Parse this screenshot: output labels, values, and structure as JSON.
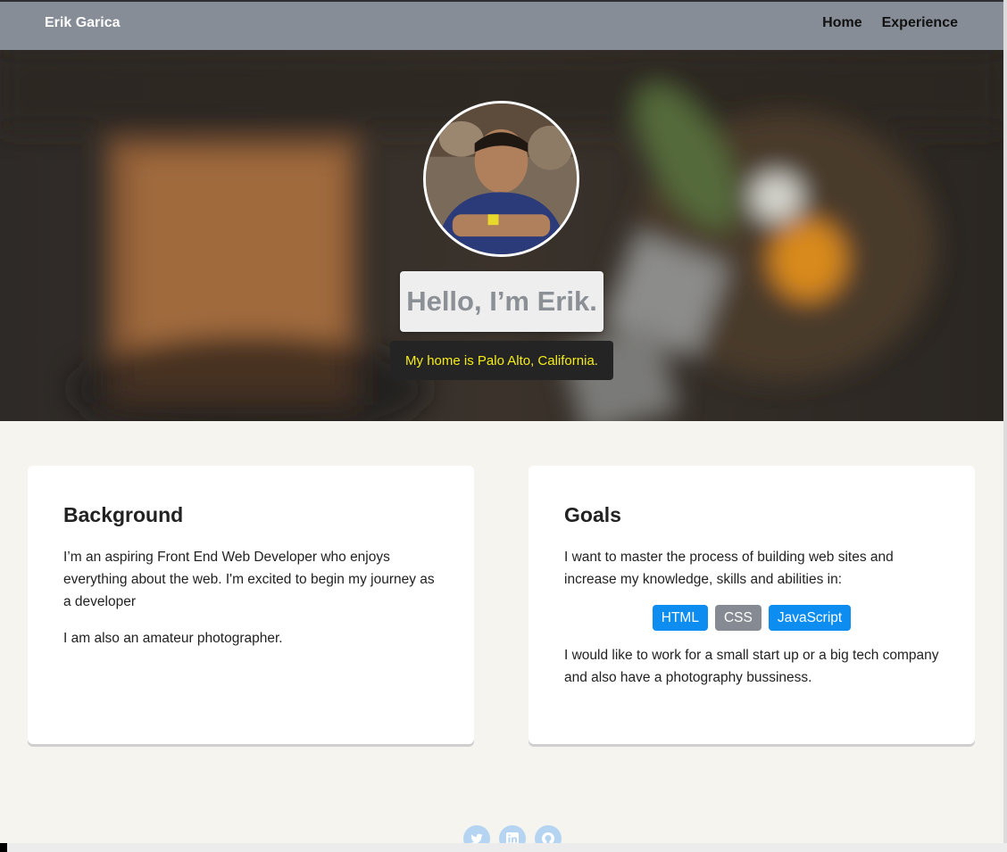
{
  "navbar": {
    "brand": "Erik Garica",
    "links": [
      "Home",
      "Experience"
    ]
  },
  "hero": {
    "greeting": "Hello, I’m Erik.",
    "location": "My home is Palo Alto, California."
  },
  "background_card": {
    "title": "Background",
    "paragraphs": [
      "I’m an aspiring Front End Web Developer who enjoys everything about the web. I'm excited to begin my journey as a developer",
      "I am also an amateur photographer."
    ]
  },
  "goals_card": {
    "title": "Goals",
    "intro": "I want to master the process of building web sites and increase my knowledge, skills and abilities in:",
    "skills": [
      {
        "label": "HTML",
        "color": "#0d8df0"
      },
      {
        "label": "CSS",
        "color": "#868b93"
      },
      {
        "label": "JavaScript",
        "color": "#0d8df0"
      }
    ],
    "outro": "I would like to work for a small start up or a big tech company and also have a photography bussiness."
  },
  "social": [
    "twitter-icon",
    "linkedin-icon",
    "github-icon"
  ],
  "colors": {
    "navbar": "#878d96",
    "page_bg": "#f5f4ef",
    "accent": "#0d8df0",
    "location_text": "#f5ec1a"
  }
}
